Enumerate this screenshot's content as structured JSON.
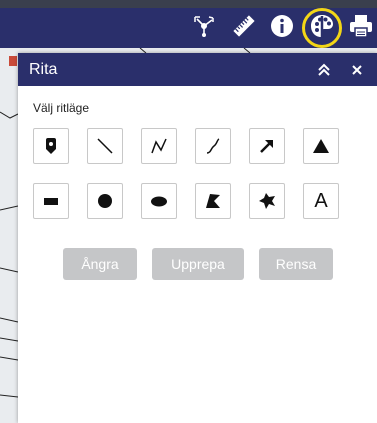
{
  "toolbar": {
    "icons": [
      "share-network-icon",
      "ruler-icon",
      "info-icon",
      "palette-icon",
      "print-icon"
    ],
    "highlight_color": "#f3d616",
    "bar_color": "#2a2f6b"
  },
  "panel": {
    "title": "Rita",
    "collapse_symbol": "≪",
    "close_symbol": "×",
    "mode_label": "Välj ritläge",
    "text_tool_label": "A",
    "actions": {
      "undo": "Ångra",
      "redo": "Upprepa",
      "clear": "Rensa"
    },
    "tools_row1": [
      "point-marker",
      "line",
      "polyline",
      "freehand-curve",
      "arrow",
      "triangle"
    ],
    "tools_row2": [
      "rectangle",
      "circle",
      "ellipse",
      "polygon",
      "freehand-shape",
      "text"
    ]
  }
}
